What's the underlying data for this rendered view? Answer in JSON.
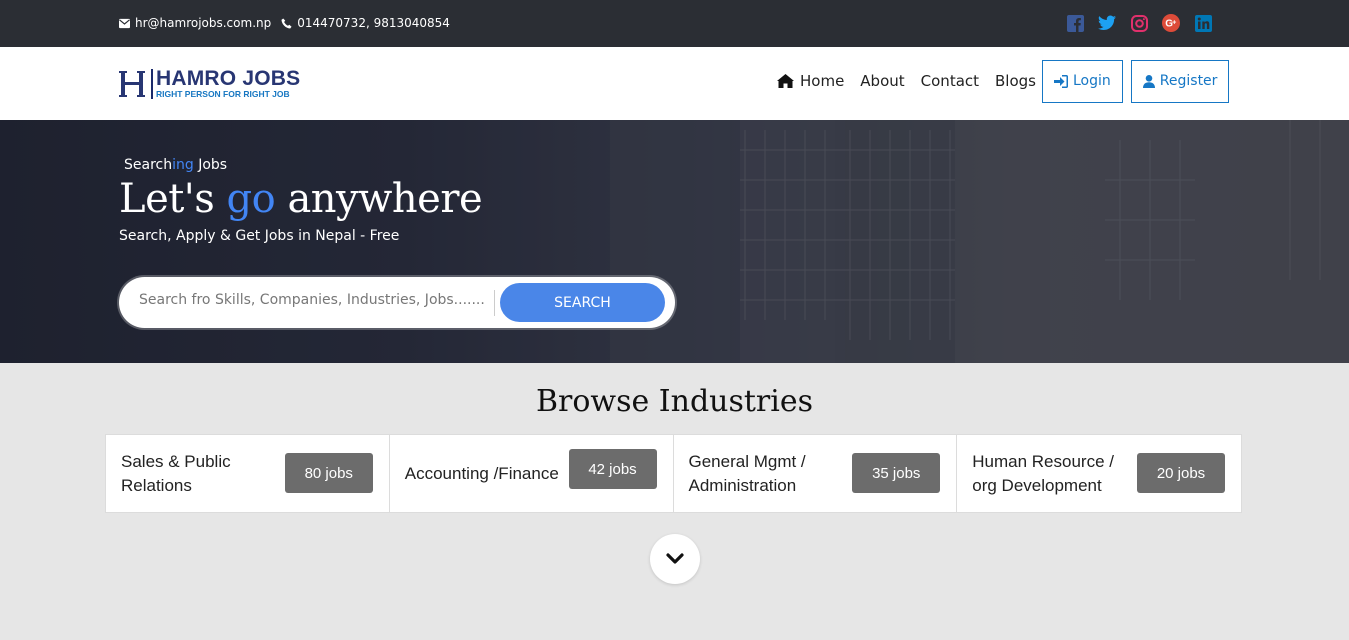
{
  "topbar": {
    "email": "hr@hamrojobs.com.np",
    "phone": "014470732, 9813040854",
    "social": [
      {
        "icon": "facebook-icon",
        "color": "#3b5998"
      },
      {
        "icon": "twitter-icon",
        "color": "#1da1f2"
      },
      {
        "icon": "instagram-icon",
        "color": "#e1306c"
      },
      {
        "icon": "google-plus-icon",
        "color": "#dd4b39"
      },
      {
        "icon": "linkedin-icon",
        "color": "#0077b5"
      }
    ]
  },
  "navbar": {
    "logo_name": "HAMRO JOBS",
    "logo_tagline": "RIGHT PERSON FOR RIGHT JOB",
    "links": [
      "Home",
      "About",
      "Contact",
      "Blogs"
    ],
    "login": "Login",
    "register": "Register"
  },
  "hero": {
    "subtitle_a": "Search",
    "subtitle_b": "ing",
    "subtitle_c": " Jobs",
    "title_a": "Let's ",
    "title_b": "go",
    "title_c": " anywhere",
    "tagline": "Search, Apply & Get Jobs in Nepal - Free",
    "search_placeholder": "Search fro Skills, Companies, Industries, Jobs.......",
    "search_button": "SEARCH"
  },
  "browse": {
    "title": "Browse Industries",
    "industries": [
      {
        "name": "Sales & Public Relations",
        "count": "80 jobs"
      },
      {
        "name": "Accounting /Finance",
        "count": "42 jobs"
      },
      {
        "name": "General Mgmt / Administration",
        "count": "35 jobs"
      },
      {
        "name": "Human Resource / org Development",
        "count": "20 jobs"
      }
    ]
  },
  "colors": {
    "accent": "#4285f4",
    "nav_button": "#1677c5",
    "topbar_bg": "#2b2e34",
    "badge_bg": "#6c6c6c"
  }
}
